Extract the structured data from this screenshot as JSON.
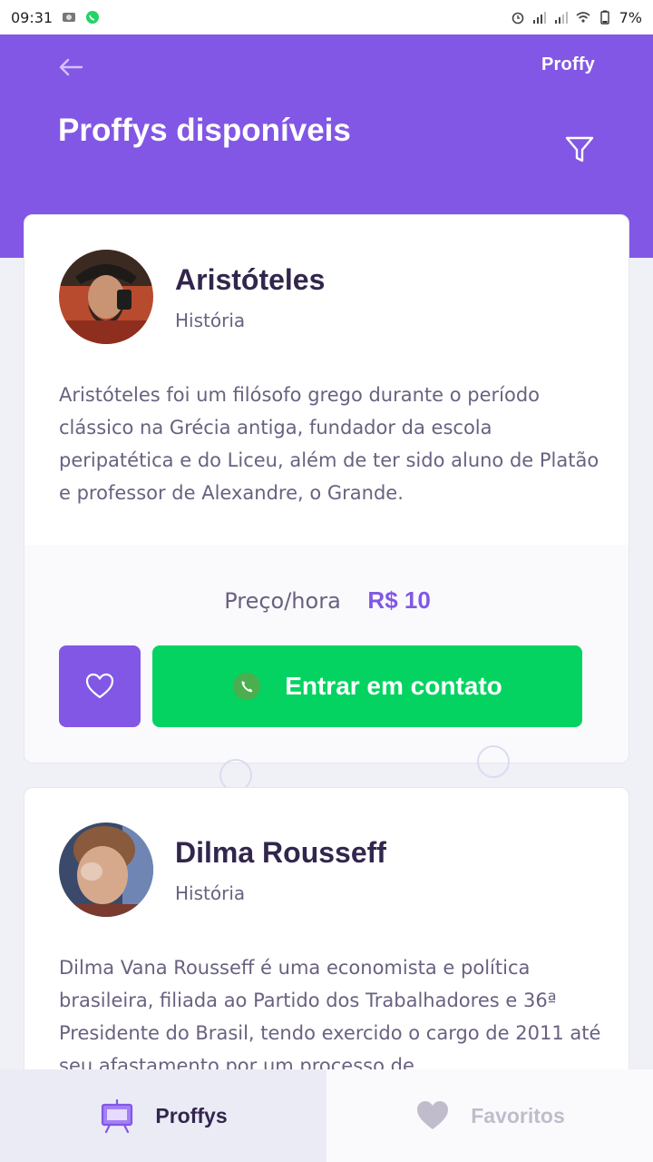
{
  "status_bar": {
    "time": "09:31",
    "battery": "7%"
  },
  "header": {
    "brand": "Proffy",
    "title": "Proffys disponíveis"
  },
  "teachers": [
    {
      "name": "Aristóteles",
      "subject": "História",
      "bio": "Aristóteles foi um filósofo grego durante o período clássico na Grécia antiga, fundador da escola peripatética e do Liceu, além de ter sido aluno de Platão e professor de Alexandre, o Grande.",
      "price_label": "Preço/hora",
      "price_value": "R$ 10",
      "contact_label": "Entrar em contato"
    },
    {
      "name": "Dilma Rousseff",
      "subject": "História",
      "bio": "Dilma Vana Rousseff é uma economista e política brasileira, filiada ao Partido dos Trabalhadores e 36ª Presidente do Brasil, tendo exercido o cargo de 2011 até seu afastamento por um processo de"
    }
  ],
  "tabs": [
    {
      "label": "Proffys",
      "icon": "easel-icon"
    },
    {
      "label": "Favoritos",
      "icon": "heart-icon"
    }
  ],
  "colors": {
    "primary": "#8257E5",
    "green": "#04D361",
    "title": "#32264D",
    "text": "#6A6180"
  }
}
